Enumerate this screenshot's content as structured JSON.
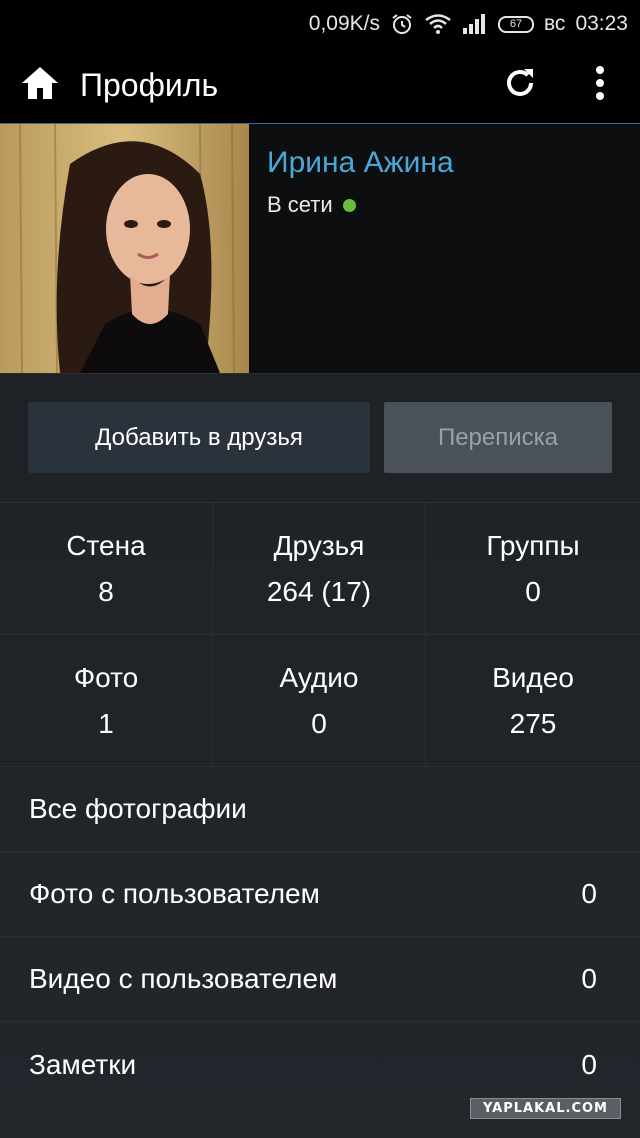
{
  "status_bar": {
    "net_speed": "0,09K/s",
    "battery_level": "67",
    "day": "вс",
    "time": "03:23",
    "icons": [
      "alarm-icon",
      "wifi-icon",
      "signal-icon",
      "battery-icon"
    ]
  },
  "action_bar": {
    "title": "Профиль",
    "icons": [
      "home-icon",
      "refresh-icon",
      "overflow-menu-icon"
    ]
  },
  "profile": {
    "name": "Ирина Ажина",
    "status": "В сети",
    "name_color": "#4aa8d8",
    "online_color": "#6abf3a"
  },
  "buttons": {
    "add_friend": "Добавить в друзья",
    "messages": "Переписка"
  },
  "stats": [
    {
      "label": "Стена",
      "value": "8"
    },
    {
      "label": "Друзья",
      "value": "264 (17)"
    },
    {
      "label": "Группы",
      "value": "0"
    },
    {
      "label": "Фото",
      "value": "1"
    },
    {
      "label": "Аудио",
      "value": "0"
    },
    {
      "label": "Видео",
      "value": "275"
    }
  ],
  "list": [
    {
      "label": "Все фотографии",
      "count": ""
    },
    {
      "label": "Фото с пользователем",
      "count": "0"
    },
    {
      "label": "Видео с пользователем",
      "count": "0"
    },
    {
      "label": "Заметки",
      "count": "0"
    }
  ],
  "watermark": "YAPLAKAL.COM"
}
